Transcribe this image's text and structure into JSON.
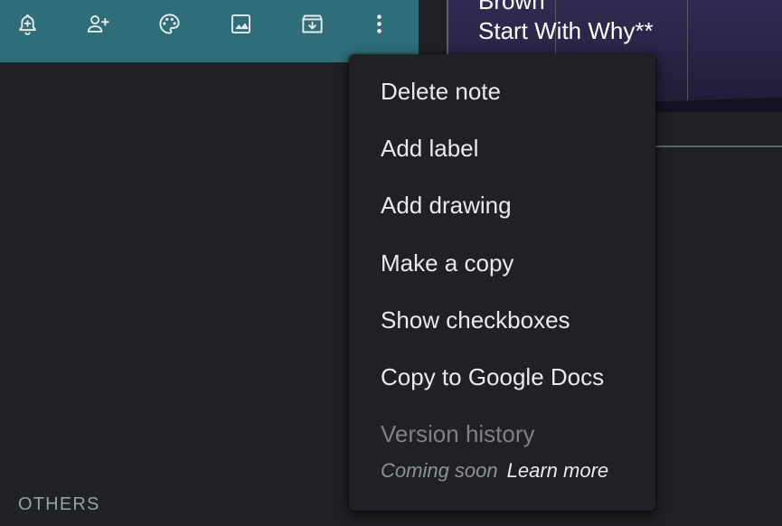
{
  "toolbar": {
    "icons": [
      "bell-plus-icon",
      "person-add-icon",
      "palette-icon",
      "image-icon",
      "archive-icon",
      "more-vert-icon"
    ]
  },
  "note": {
    "text_line_1": "Brown",
    "text_line_2": "Start With Why**"
  },
  "menu": {
    "items": [
      {
        "label": "Delete note"
      },
      {
        "label": "Add label"
      },
      {
        "label": "Add drawing"
      },
      {
        "label": "Make a copy"
      },
      {
        "label": "Show checkboxes"
      },
      {
        "label": "Copy to Google Docs"
      },
      {
        "label": "Version history"
      }
    ],
    "coming_soon": "Coming soon",
    "learn_more": "Learn more"
  },
  "section": {
    "others_label": "OTHERS"
  },
  "colors": {
    "background": "#202124",
    "toolbar": "#2d6e79",
    "menu_text": "#e8eaed",
    "disabled_text": "#7f8186"
  }
}
